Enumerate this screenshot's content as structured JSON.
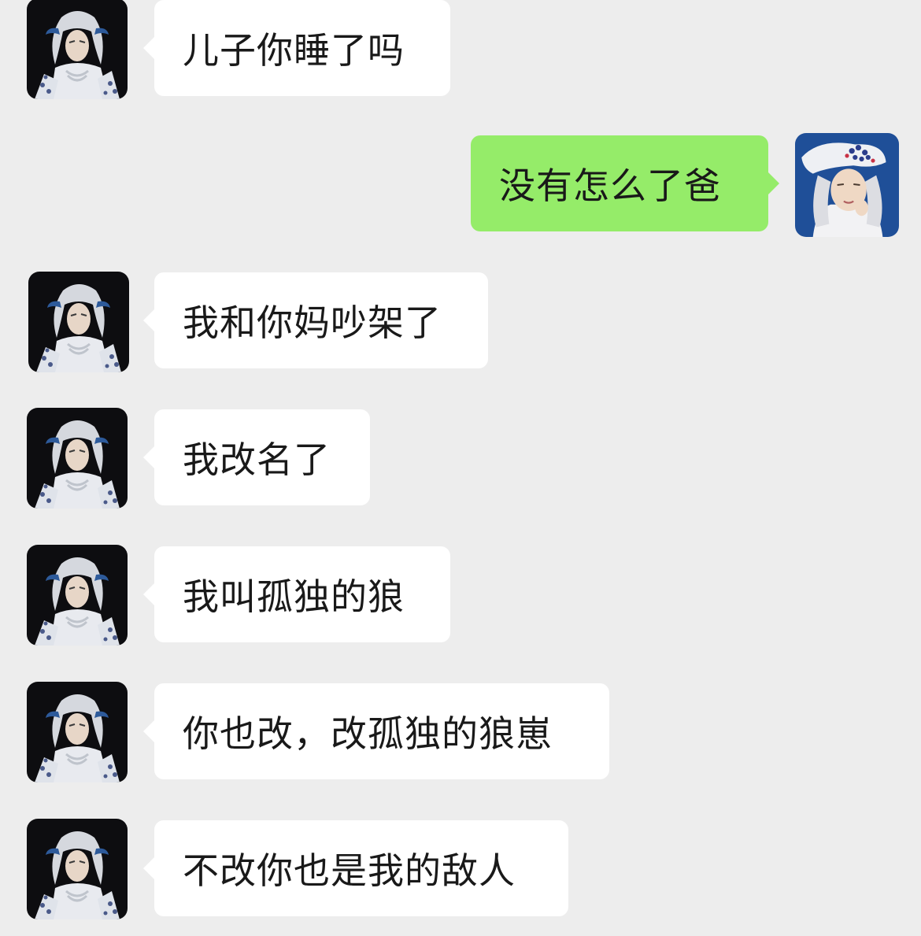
{
  "chat": {
    "messages": [
      {
        "sender": "father",
        "text": "儿子你睡了吗"
      },
      {
        "sender": "me",
        "text": "没有怎么了爸"
      },
      {
        "sender": "father",
        "text": "我和你妈吵架了"
      },
      {
        "sender": "father",
        "text": "我改名了"
      },
      {
        "sender": "father",
        "text": "我叫孤独的狼"
      },
      {
        "sender": "father",
        "text": "你也改，改孤独的狼崽"
      },
      {
        "sender": "father",
        "text": "不改你也是我的敌人"
      }
    ]
  },
  "colors": {
    "background": "#ededed",
    "incoming_bubble": "#ffffff",
    "outgoing_bubble": "#95ec69"
  },
  "icons": {
    "father_avatar": "white-haired-puppet-avatar-icon",
    "my_avatar": "white-hat-puppet-avatar-icon"
  }
}
